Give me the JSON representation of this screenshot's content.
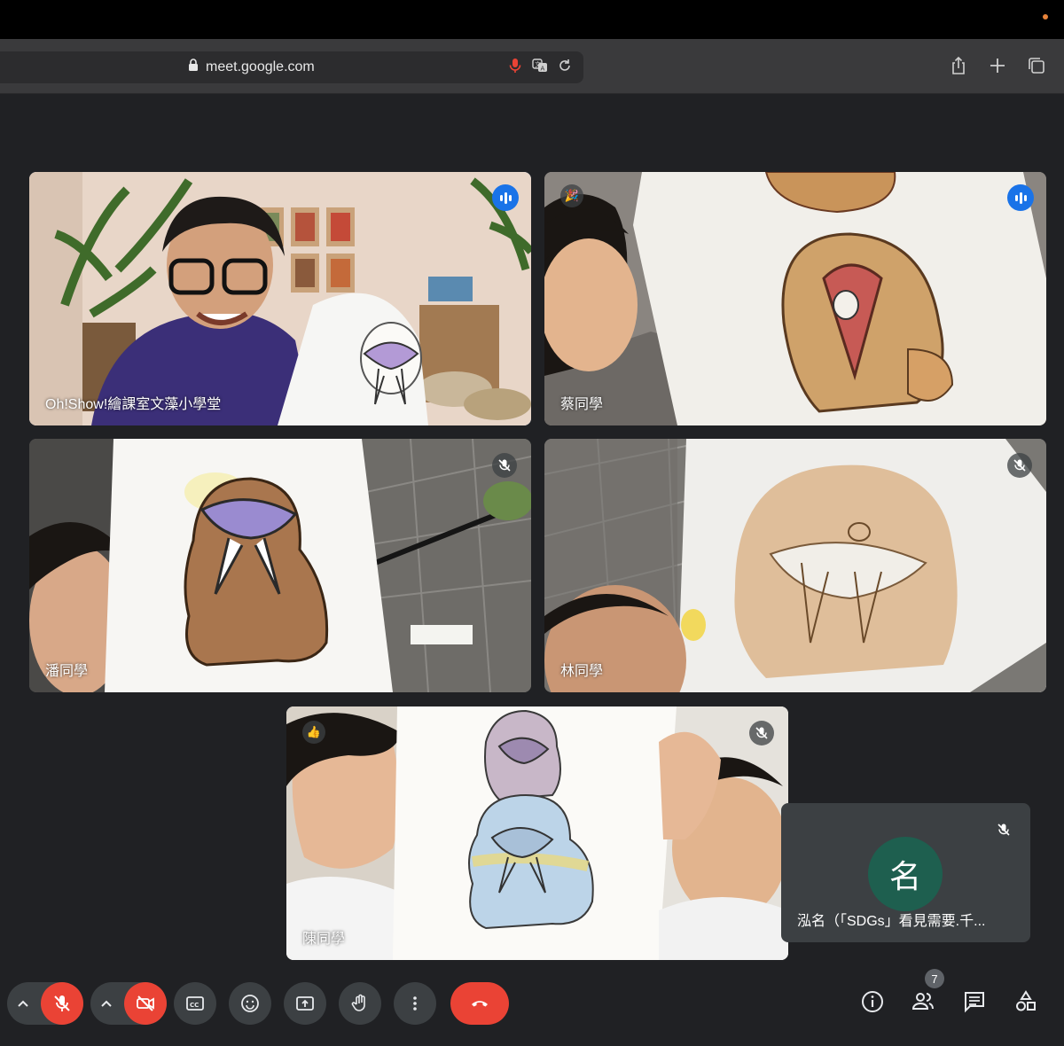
{
  "browser": {
    "url": "meet.google.com",
    "icons": [
      "lock-icon",
      "mic-recording-icon",
      "translate-icon",
      "reload-icon",
      "share-icon",
      "new-tab-icon",
      "tabs-overview-icon"
    ]
  },
  "participants": [
    {
      "name": "Oh!Show!繪課室文藻小學堂",
      "speaking": true,
      "muted": false,
      "active": true
    },
    {
      "name": "蔡同學",
      "speaking": true,
      "muted": false,
      "reaction": "party-popper-icon"
    },
    {
      "name": "潘同學",
      "speaking": false,
      "muted": true
    },
    {
      "name": "林同學",
      "speaking": false,
      "muted": true
    },
    {
      "name": "陳同學",
      "speaking": false,
      "muted": true,
      "reaction": "thumbs-up-icon"
    },
    {
      "name": "泓名（「SDGs」看見需要.千...",
      "initial": "名",
      "muted": true,
      "camera_off": true
    }
  ],
  "controls": {
    "mic": "muted",
    "camera": "off",
    "participant_count": "7",
    "buttons": [
      "mic-toggle",
      "camera-toggle",
      "captions",
      "reactions",
      "present-screen",
      "raise-hand",
      "more-options",
      "leave-call",
      "meeting-info",
      "people",
      "chat",
      "activities"
    ]
  },
  "colors": {
    "active_border": "#8ab4f8",
    "speaking": "#1a73e8",
    "danger": "#ea4335",
    "background": "#202124",
    "avatar": "#1e5f4f"
  }
}
